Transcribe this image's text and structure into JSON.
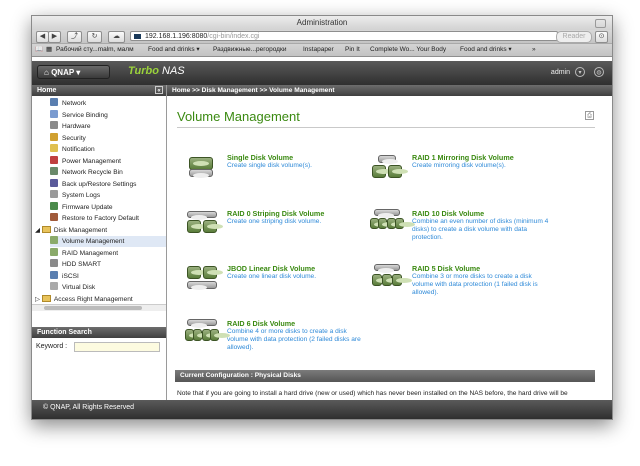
{
  "window": {
    "title": "Administration"
  },
  "browser": {
    "url_host": "192.168.1.196:8080",
    "url_path": "/cgi-bin/index.cgi",
    "reader_label": "Reader",
    "bookmarks": [
      "Рабочий сту...malm, малм",
      "Food and drinks ▾",
      "Раздвижные...регородки",
      "Instapaper",
      "Pin It",
      "Complete Wo... Your Body",
      "Food and drinks ▾"
    ]
  },
  "header": {
    "logo": "QNAP",
    "turbo": "Turbo",
    "nas": "NAS",
    "user": "admin"
  },
  "sidebar": {
    "title": "Home",
    "items": [
      "Network",
      "Service Binding",
      "Hardware",
      "Security",
      "Notification",
      "Power Management",
      "Network Recycle Bin",
      "Back up/Restore Settings",
      "System Logs",
      "Firmware Update",
      "Restore to Factory Default"
    ],
    "group": "Disk Management",
    "subitems": [
      "Volume Management",
      "RAID Management",
      "HDD SMART",
      "iSCSI",
      "Virtual Disk"
    ],
    "next_group": "Access Right Management",
    "function_search": "Function Search",
    "keyword_label": "Keyword :"
  },
  "breadcrumb": "Home >> Disk Management >> Volume Management",
  "page": {
    "title": "Volume Management",
    "volumes": [
      {
        "name": "Single Disk Volume",
        "desc": "Create single disk volume(s)."
      },
      {
        "name": "RAID 1 Mirroring Disk Volume",
        "desc": "Create mirroring disk volume(s)."
      },
      {
        "name": "RAID 0 Striping Disk Volume",
        "desc": "Create one striping disk volume."
      },
      {
        "name": "RAID 10 Disk Volume",
        "desc": "Combine an even number of disks (minimum 4 disks) to create a disk volume with data protection."
      },
      {
        "name": "JBOD Linear Disk Volume",
        "desc": "Create one linear disk volume."
      },
      {
        "name": "RAID 5 Disk Volume",
        "desc": "Combine 3 or more disks to create a disk volume with data protection (1 failed disk is allowed)."
      },
      {
        "name": "RAID 6 Disk Volume",
        "desc": "Combine 4 or more disks to create a disk volume with data protection (2 failed disks are allowed)."
      }
    ],
    "config_header": "Current Configuration : Physical Disks",
    "note": "Note that if you are going to install a hard drive (new or used) which has never been installed on the NAS before, the hard drive will be formatted and partitioned automatically and all the disk data will be cleared."
  },
  "footer": "© QNAP, All Rights Reserved",
  "colors": {
    "accent_green": "#3b8a12",
    "link_blue": "#2f8ad8",
    "header_dark": "#3f3f3f"
  }
}
